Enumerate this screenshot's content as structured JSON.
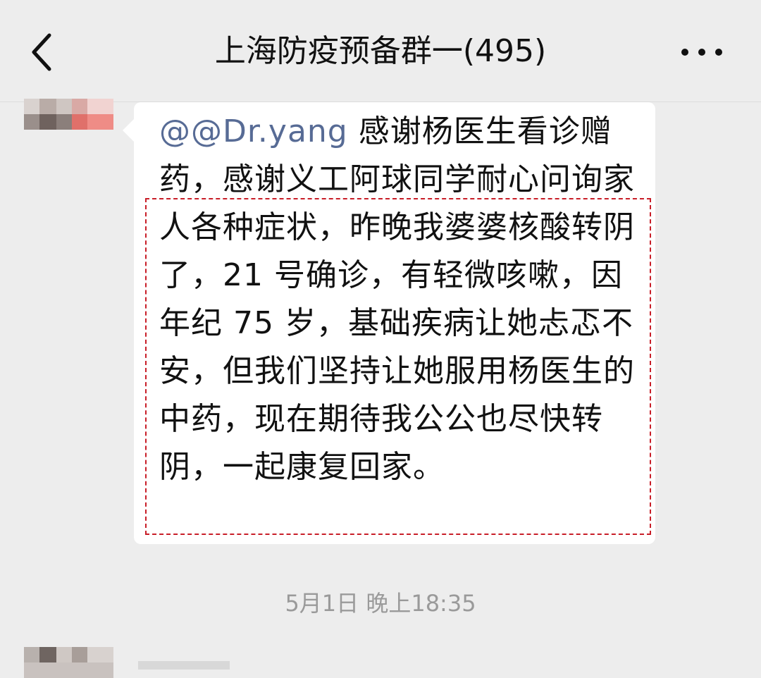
{
  "header": {
    "title": "上海防疫预备群一(495)",
    "back_icon": "chevron-left-icon",
    "more_icon": "more-dots-icon"
  },
  "message": {
    "mention": "@@Dr.yang",
    "text_line1_rest": " 感谢杨医生看诊",
    "text_rest": "赠药，感谢义工阿球同学耐心问询家人各种症状，昨晚我婆婆核酸转阴了，21 号确诊，有轻微咳嗽，因年纪 75 岁，基础疾病让她忐忑不安，但我们坚持让她服用杨医生的中药，现在期待我公公也尽快转阴，一起康复回家。"
  },
  "timestamp": "5月1日 晚上18:35",
  "colors": {
    "background": "#ededed",
    "bubble": "#ffffff",
    "mention": "#576b95",
    "highlight_border": "#c81e28",
    "timestamp": "#9a9a9a"
  }
}
